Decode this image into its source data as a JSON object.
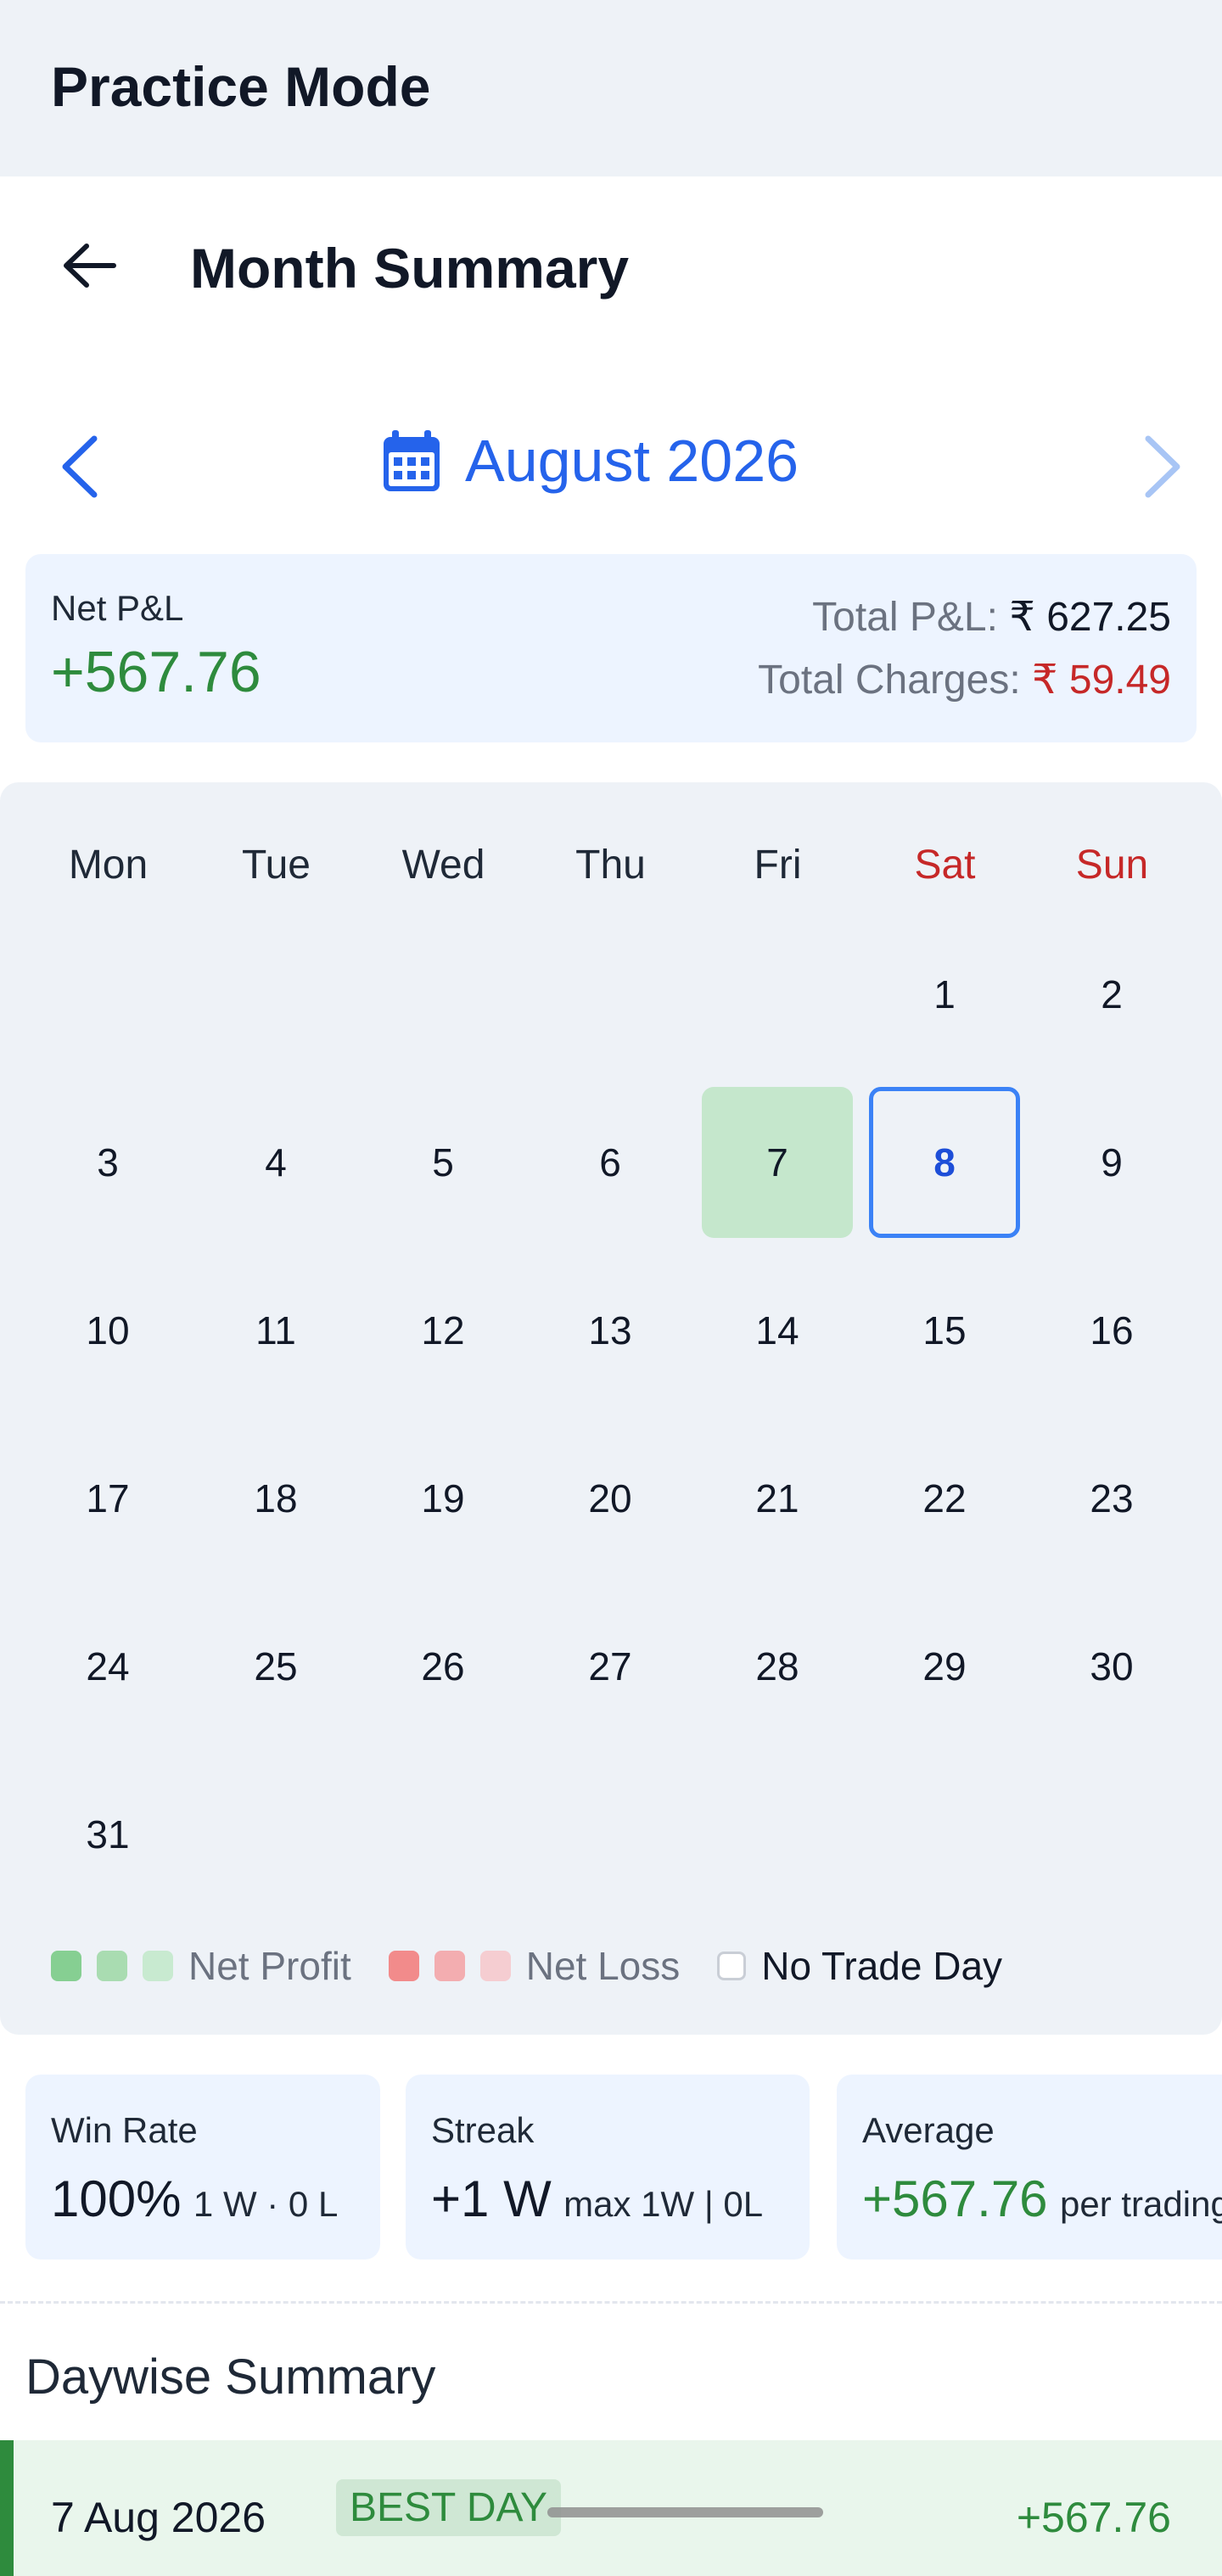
{
  "app": {
    "title": "Practice Mode"
  },
  "header": {
    "title": "Month Summary"
  },
  "month_nav": {
    "label": "August 2026"
  },
  "pl_summary": {
    "net_label": "Net P&L",
    "net_value": "+567.76",
    "total_pl_label": "Total P&L:",
    "total_pl_value": "₹ 627.25",
    "total_charges_label": "Total Charges:",
    "total_charges_value": "₹ 59.49"
  },
  "calendar": {
    "weekdays": [
      "Mon",
      "Tue",
      "Wed",
      "Thu",
      "Fri",
      "Sat",
      "Sun"
    ],
    "first_weekday_index": 5,
    "days_in_month": 31,
    "profit_days": [
      7
    ],
    "today": 8
  },
  "legend": {
    "profit_label": "Net Profit",
    "loss_label": "Net Loss",
    "no_trade_label": "No Trade Day"
  },
  "colors": {
    "accent": "#2563eb",
    "profit": "#2e8b3d",
    "loss": "#c62828",
    "profit_swatches": [
      "#86cf92",
      "#a9dcb1",
      "#c8ead0"
    ],
    "loss_swatches": [
      "#f28b8b",
      "#f3adb0",
      "#f5cdd1"
    ]
  },
  "stats": {
    "win_rate": {
      "label": "Win Rate",
      "value": "100%",
      "detail": "1 W · 0 L"
    },
    "streak": {
      "label": "Streak",
      "value": "+1 W",
      "detail": "max 1W | 0L"
    },
    "average": {
      "label": "Average",
      "value": "+567.76",
      "detail": "per trading day"
    }
  },
  "daywise": {
    "title": "Daywise Summary",
    "rows": [
      {
        "date": "7 Aug 2026",
        "badge": "BEST DAY",
        "amount": "+567.76"
      }
    ]
  }
}
